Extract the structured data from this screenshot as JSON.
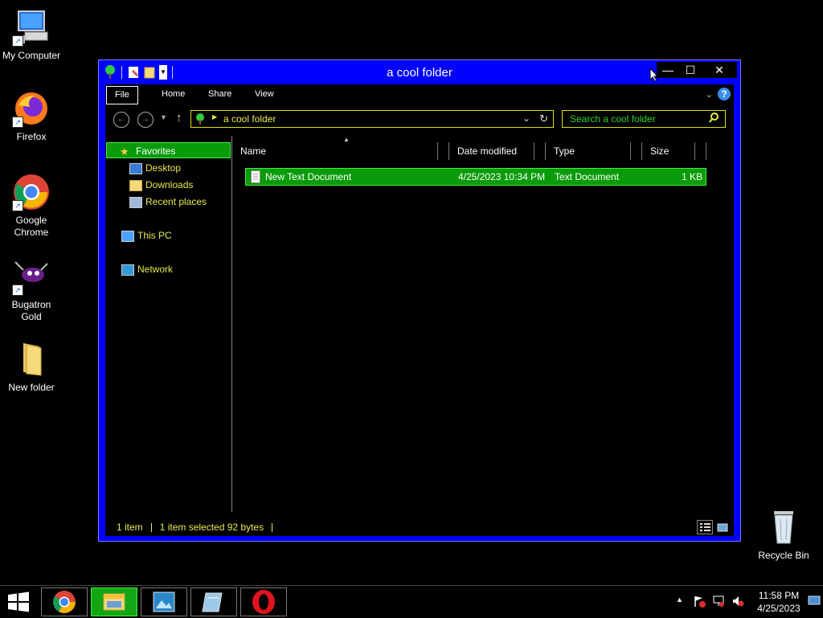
{
  "desktop": {
    "icons": [
      {
        "label": "My Computer"
      },
      {
        "label": "Firefox"
      },
      {
        "label": "Google Chrome"
      },
      {
        "label": "Bugatron Gold"
      },
      {
        "label": "New folder"
      },
      {
        "label": "Recycle Bin"
      }
    ]
  },
  "window": {
    "title": "a cool folder",
    "controls": {
      "minimize": "—",
      "maximize": "☐",
      "close": "✕"
    }
  },
  "ribbon": {
    "tabs": [
      {
        "label": "File"
      },
      {
        "label": "Home"
      },
      {
        "label": "Share"
      },
      {
        "label": "View"
      }
    ],
    "help": "?"
  },
  "address_bar": {
    "path": "a cool folder"
  },
  "search": {
    "placeholder": "Search a cool folder"
  },
  "nav_pane": {
    "favorites": "Favorites",
    "items": [
      {
        "label": "Desktop"
      },
      {
        "label": "Downloads"
      },
      {
        "label": "Recent places"
      }
    ],
    "this_pc": "This PC",
    "network": "Network"
  },
  "columns": {
    "name": "Name",
    "date": "Date modified",
    "type": "Type",
    "size": "Size"
  },
  "files": [
    {
      "name": "New Text Document",
      "date": "4/25/2023 10:34 PM",
      "type": "Text Document",
      "size": "1 KB"
    }
  ],
  "status": {
    "count": "1 item",
    "selected": "1 item selected  92 bytes"
  },
  "taskbar": {
    "apps": [
      "start-menu",
      "google-chrome",
      "file-explorer",
      "photos",
      "notepad",
      "opera"
    ],
    "time": "11:58 PM",
    "date": "4/25/2023"
  },
  "colors": {
    "window_frame": "#0000ff",
    "selection": "#0a9b0a",
    "text_yellow": "#e8e84a",
    "search_text": "#29d129"
  }
}
